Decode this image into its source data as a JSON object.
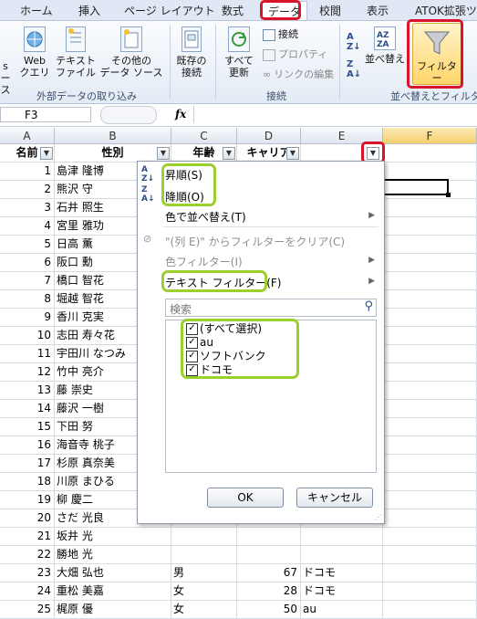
{
  "ribbon_tabs": [
    "ホーム",
    "挿入",
    "ページ レイアウト",
    "数式",
    "データ",
    "校閲",
    "表示",
    "ATOK拡張ツー"
  ],
  "ribbon": {
    "partial_label_1": "s",
    "partial_label_2": "ース",
    "web_query_l1": "Web",
    "web_query_l2": "クエリ",
    "text_file_l1": "テキスト",
    "text_file_l2": "ファイル",
    "other_source_l1": "その他の",
    "other_source_l2": "データ ソース",
    "group_external": "外部データの取り込み",
    "existing_conn_l1": "既存の",
    "existing_conn_l2": "接続",
    "refresh_all_l1": "すべて",
    "refresh_all_l2": "更新",
    "connections": "接続",
    "properties": "プロパティ",
    "edit_links": "リンクの編集",
    "group_connections": "接続",
    "sort_label": "並べ替え",
    "filter_label": "フィルター",
    "group_sort_filter": "並べ替えとフィルター"
  },
  "formula_bar": {
    "name_box": "F3",
    "fx": "fx"
  },
  "columns": [
    "A",
    "B",
    "C",
    "D",
    "E",
    "F"
  ],
  "headers": {
    "a": "名前",
    "b": "性別",
    "c": "年齢",
    "d": "キャリア"
  },
  "rows": [
    {
      "n": "1",
      "name": "島津 隆博"
    },
    {
      "n": "2",
      "name": "熊沢 守"
    },
    {
      "n": "3",
      "name": "石井 照生"
    },
    {
      "n": "4",
      "name": "宮里 雅功"
    },
    {
      "n": "5",
      "name": "日高 薫"
    },
    {
      "n": "6",
      "name": "阪口 勳"
    },
    {
      "n": "7",
      "name": "橋口 智花"
    },
    {
      "n": "8",
      "name": "堀越 智花"
    },
    {
      "n": "9",
      "name": "香川 克実"
    },
    {
      "n": "10",
      "name": "志田 寿々花"
    },
    {
      "n": "11",
      "name": "宇田川 なつみ"
    },
    {
      "n": "12",
      "name": "竹中 亮介"
    },
    {
      "n": "13",
      "name": "藤 崇史"
    },
    {
      "n": "14",
      "name": "藤沢 一樹"
    },
    {
      "n": "15",
      "name": "下田 努"
    },
    {
      "n": "16",
      "name": "海音寺 桃子"
    },
    {
      "n": "17",
      "name": "杉原 真奈美"
    },
    {
      "n": "18",
      "name": "川原 まひる"
    },
    {
      "n": "19",
      "name": "柳 慶二"
    },
    {
      "n": "20",
      "name": "さだ 光良"
    },
    {
      "n": "21",
      "name": "坂井 光"
    },
    {
      "n": "22",
      "name": "勝地 光"
    },
    {
      "n": "23",
      "name": "大畑 弘也",
      "sex": "男",
      "age": "67",
      "carrier": "ドコモ"
    },
    {
      "n": "24",
      "name": "重松 美嘉",
      "sex": "女",
      "age": "28",
      "carrier": "ドコモ"
    },
    {
      "n": "25",
      "name": "梶原 優",
      "sex": "女",
      "age": "50",
      "carrier": "au"
    }
  ],
  "menu": {
    "sort_asc": "昇順(S)",
    "sort_desc": "降順(O)",
    "sort_by_color": "色で並べ替え(T)",
    "clear_filter": "\"(列 E)\" からフィルターをクリア(C)",
    "color_filter": "色フィルター(I)",
    "text_filter": "テキスト フィルター(F)",
    "search_placeholder": "検索",
    "items": [
      "(すべて選択)",
      "au",
      "ソフトバンク",
      "ドコモ"
    ],
    "ok": "OK",
    "cancel": "キャンセル"
  }
}
